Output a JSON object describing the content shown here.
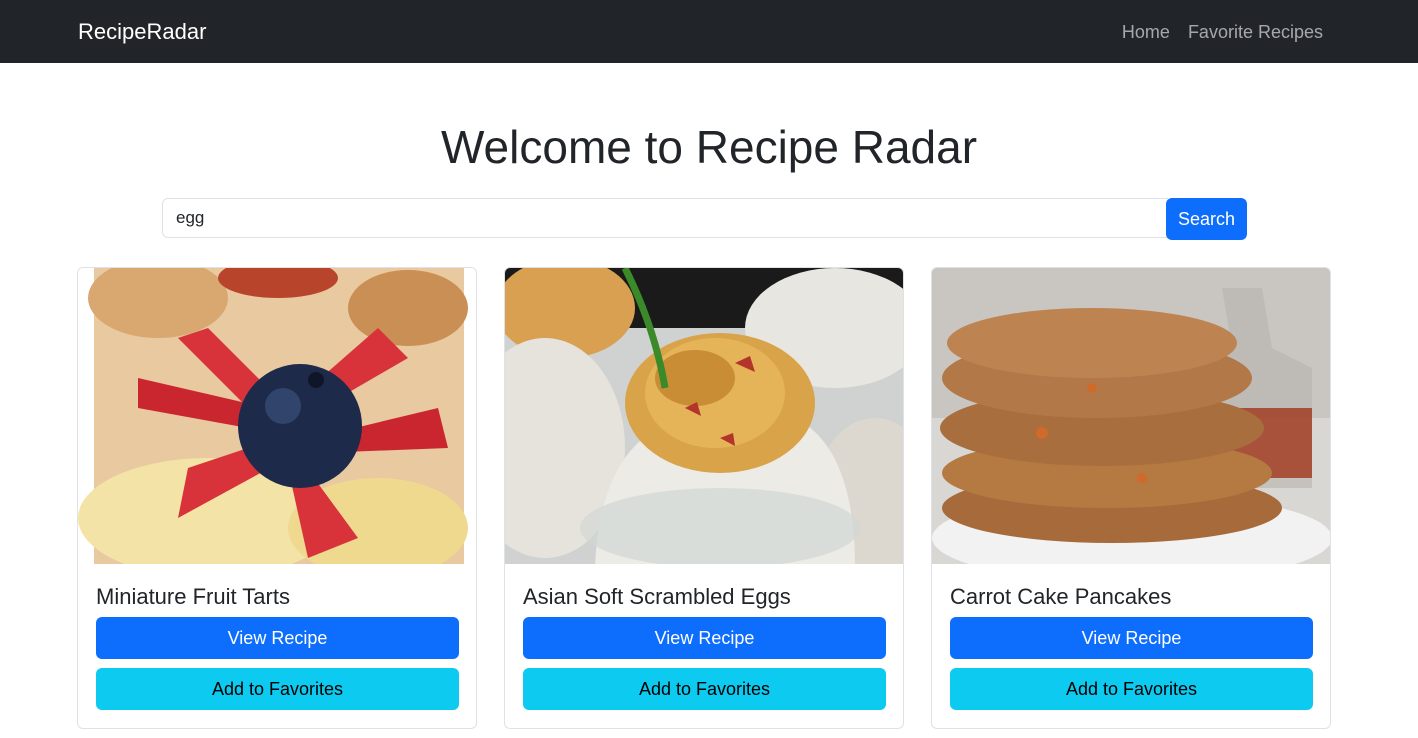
{
  "navbar": {
    "brand": "RecipeRadar",
    "links": [
      "Home",
      "Favorite Recipes"
    ]
  },
  "main": {
    "title": "Welcome to Recipe Radar",
    "search": {
      "value": "egg",
      "button_label": "Search"
    },
    "recipes": [
      {
        "title": "Miniature Fruit Tarts",
        "image": "fruit-tart-photo",
        "view_label": "View Recipe",
        "fav_label": "Add to Favorites"
      },
      {
        "title": "Asian Soft Scrambled Eggs",
        "image": "scrambled-eggs-in-shell-photo",
        "view_label": "View Recipe",
        "fav_label": "Add to Favorites"
      },
      {
        "title": "Carrot Cake Pancakes",
        "image": "pancake-stack-photo",
        "view_label": "View Recipe",
        "fav_label": "Add to Favorites"
      }
    ]
  },
  "colors": {
    "navbar_bg": "#212529",
    "primary": "#0d6efd",
    "info": "#0dcaf0"
  }
}
